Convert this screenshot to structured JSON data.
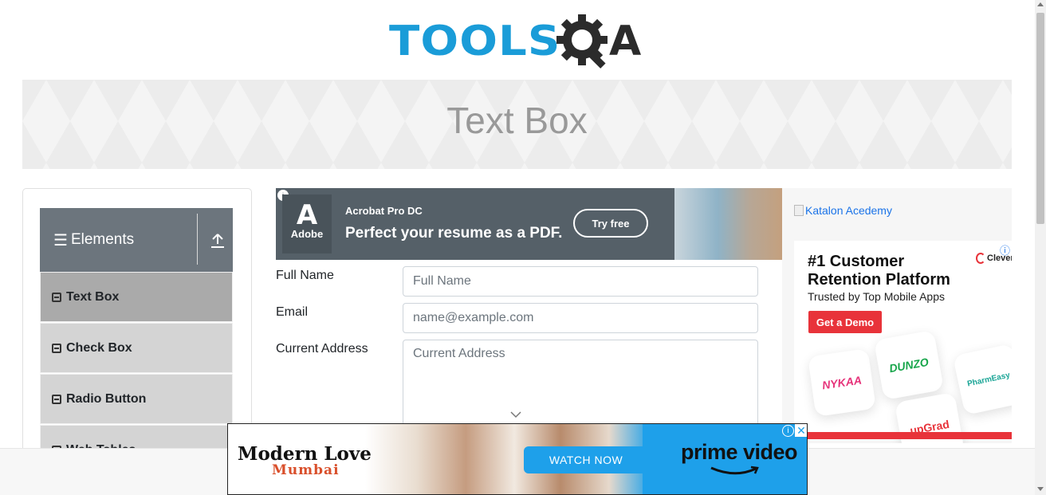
{
  "header": {
    "logo_left": "TOOLS",
    "logo_right": "A"
  },
  "banner": {
    "title": "Text Box"
  },
  "sidebar": {
    "group_title": "Elements",
    "items": [
      {
        "label": "Text Box",
        "active": true
      },
      {
        "label": "Check Box",
        "active": false
      },
      {
        "label": "Radio Button",
        "active": false
      },
      {
        "label": "Web Tables",
        "active": false
      }
    ]
  },
  "top_ad": {
    "brand": "Adobe",
    "product": "Acrobat Pro DC",
    "tagline": "Perfect your resume as a PDF.",
    "cta": "Try free"
  },
  "form": {
    "full_name_label": "Full Name",
    "full_name_placeholder": "Full Name",
    "email_label": "Email",
    "email_placeholder": "name@example.com",
    "current_address_label": "Current Address",
    "current_address_placeholder": "Current Address"
  },
  "right_ad": {
    "katalon_alt": "Katalon Acedemy",
    "headline": "#1 Customer Retention Platform",
    "subline": "Trusted by Top Mobile Apps",
    "cta": "Get a Demo",
    "brand": "CleverTap",
    "tiles": [
      "NYKAA",
      "DUNZO",
      "PharmEasy",
      "upGrad"
    ],
    "accent_color": "#e8333a"
  },
  "bottom_ad": {
    "title": "Modern Love",
    "subtitle": "Mumbai",
    "cta": "WATCH NOW",
    "brand": "prime video",
    "accent_color": "#1ea0ea"
  }
}
